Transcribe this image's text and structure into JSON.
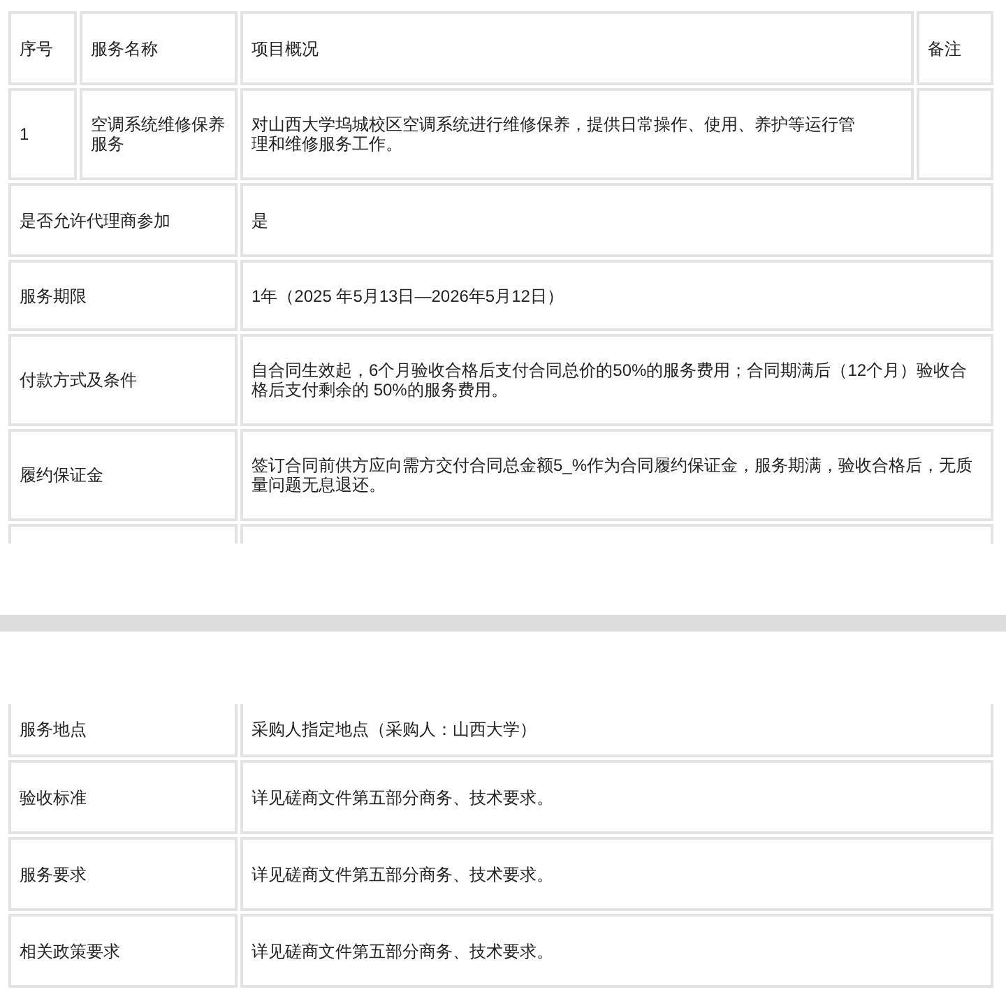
{
  "table": {
    "columns": [
      "序号",
      "服务名称",
      "项目概况",
      "备注"
    ],
    "rows": [
      {
        "cells": [
          "1",
          "空调系统维修保养服务",
          "对山西大学坞城校区空调系统进行维修保养，提供日常操作、使用、养护等运行管理和维修服务工作。",
          ""
        ]
      }
    ]
  },
  "details": [
    {
      "label": "是否允许代理商参加",
      "value": "是"
    },
    {
      "label": "服务期限",
      "value": "1年（2025 年5月13日—2026年5月12日）"
    },
    {
      "label": "付款方式及条件",
      "value": "自合同生效起，6个月验收合格后支付合同总价的50%的服务费用；合同期满后（12个月）验收合格后支付剩余的 50%的服务费用。"
    },
    {
      "label": "履约保证金",
      "value": "签订合同前供方应向需方交付合同总金额5_%作为合同履约保证金，服务期满，验收合格后，无质量问题无息退还。"
    }
  ],
  "details_continued": [
    {
      "label": "服务地点",
      "value": "采购人指定地点（采购人：山西大学）"
    },
    {
      "label": "验收标准",
      "value": "详见磋商文件第五部分商务、技术要求。"
    },
    {
      "label": "服务要求",
      "value": "详见磋商文件第五部分商务、技术要求。"
    },
    {
      "label": "相关政策要求",
      "value": "详见磋商文件第五部分商务、技术要求。"
    }
  ]
}
